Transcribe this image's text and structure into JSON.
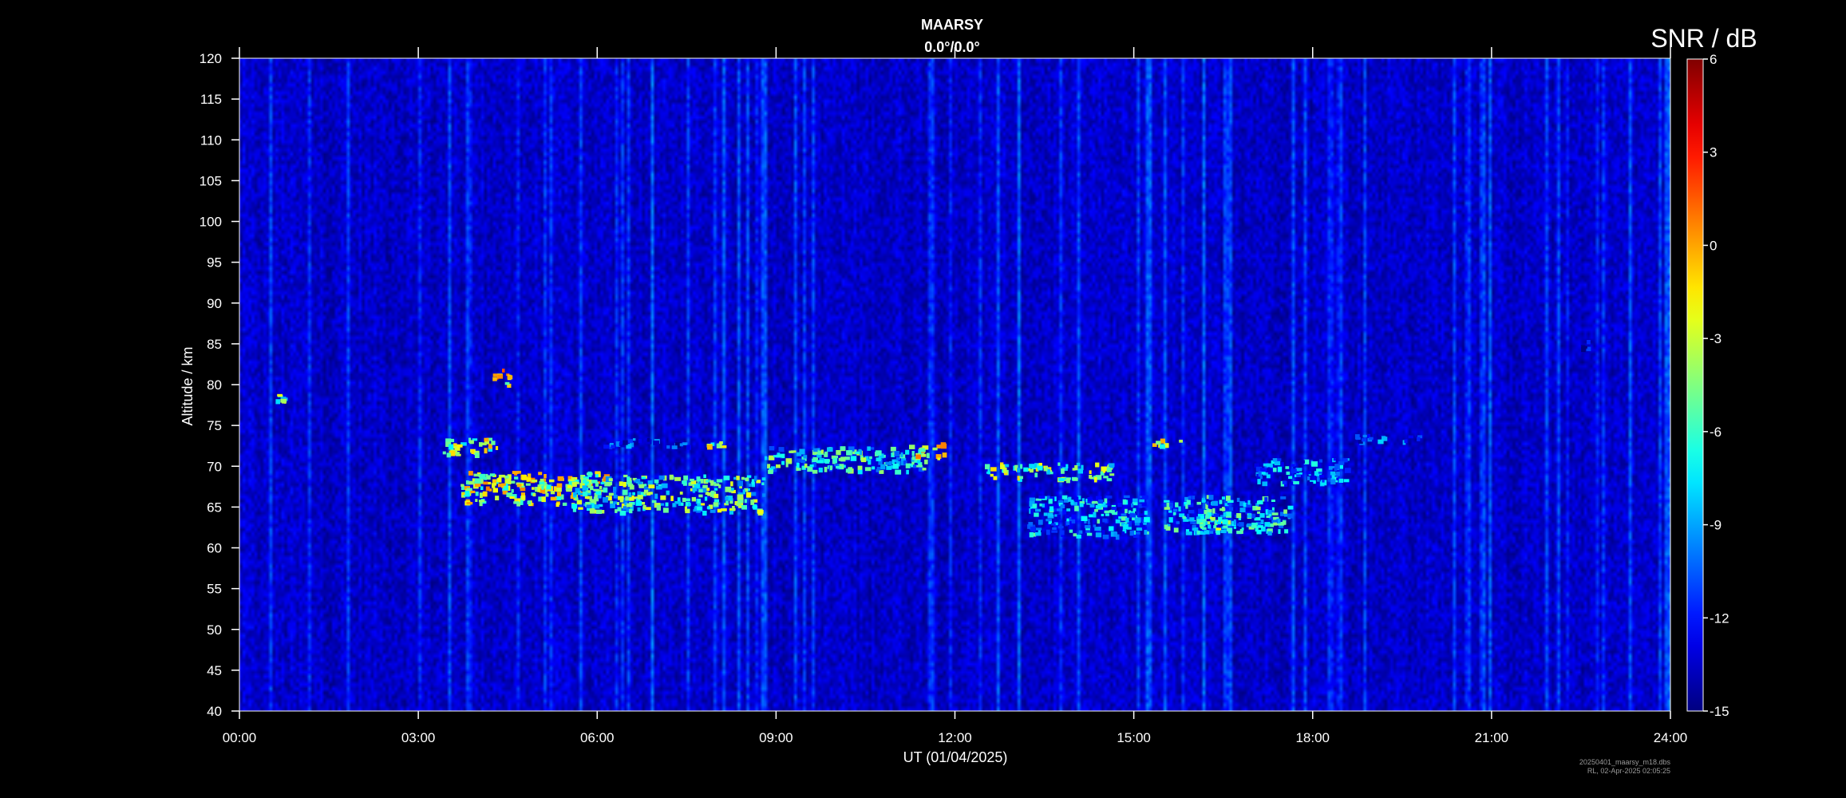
{
  "chart_data": {
    "type": "heatmap",
    "title": "MAARSY",
    "subtitle": "0.0°/0.0°",
    "xlabel": "UT (01/04/2025)",
    "ylabel": "Altitude / km",
    "xlim": [
      0,
      24
    ],
    "ylim": [
      40,
      120
    ],
    "xticks": [
      0,
      3,
      6,
      9,
      12,
      15,
      18,
      21,
      24
    ],
    "xtick_labels": [
      "00:00",
      "03:00",
      "06:00",
      "09:00",
      "12:00",
      "15:00",
      "18:00",
      "21:00",
      "24:00"
    ],
    "yticks": [
      40,
      45,
      50,
      55,
      60,
      65,
      70,
      75,
      80,
      85,
      90,
      95,
      100,
      105,
      110,
      115,
      120
    ],
    "ytick_labels": [
      "40",
      "45",
      "50",
      "55",
      "60",
      "65",
      "70",
      "75",
      "80",
      "85",
      "90",
      "95",
      "100",
      "105",
      "110",
      "115",
      "120"
    ],
    "colorbar": {
      "label": "SNR / dB",
      "range": [
        -15,
        6
      ],
      "ticks": [
        6,
        3,
        0,
        -3,
        -6,
        -9,
        -12,
        -15
      ],
      "tick_labels": [
        "6",
        "3",
        "0",
        "-3",
        "-6",
        "-9",
        "-12",
        "-15"
      ],
      "colormap": "jet",
      "placement": "right"
    },
    "background_snr": -13.5,
    "echo_regions": [
      {
        "t_start": 3.4,
        "t_end": 4.3,
        "alt_low": 71.5,
        "alt_high": 73.5,
        "snr": 0
      },
      {
        "t_start": 3.7,
        "t_end": 6.2,
        "alt_low": 65.5,
        "alt_high": 69.5,
        "snr": 1
      },
      {
        "t_start": 5.5,
        "t_end": 8.8,
        "alt_low": 64.5,
        "alt_high": 69,
        "snr": -2
      },
      {
        "t_start": 4.2,
        "t_end": 4.5,
        "alt_low": 80,
        "alt_high": 82,
        "snr": 2
      },
      {
        "t_start": 6.1,
        "t_end": 7.5,
        "alt_low": 72.5,
        "alt_high": 73.5,
        "snr": -8
      },
      {
        "t_start": 7.8,
        "t_end": 8.1,
        "alt_low": 72.5,
        "alt_high": 73.2,
        "snr": 0
      },
      {
        "t_start": 8.8,
        "t_end": 11.5,
        "alt_low": 69.5,
        "alt_high": 72.5,
        "snr": -3
      },
      {
        "t_start": 11.2,
        "t_end": 11.8,
        "alt_low": 71,
        "alt_high": 73,
        "snr": 1
      },
      {
        "t_start": 12.5,
        "t_end": 14.6,
        "alt_low": 68.5,
        "alt_high": 70.5,
        "snr": -1
      },
      {
        "t_start": 13.2,
        "t_end": 15.2,
        "alt_low": 61.5,
        "alt_high": 66.5,
        "snr": -5
      },
      {
        "t_start": 15.5,
        "t_end": 17.6,
        "alt_low": 62,
        "alt_high": 66.5,
        "snr": -4
      },
      {
        "t_start": 16,
        "t_end": 16.6,
        "alt_low": 62,
        "alt_high": 64,
        "snr": -1
      },
      {
        "t_start": 15.3,
        "t_end": 15.8,
        "alt_low": 72.5,
        "alt_high": 73.5,
        "snr": 0
      },
      {
        "t_start": 17,
        "t_end": 18.6,
        "alt_low": 68,
        "alt_high": 71,
        "snr": -6
      },
      {
        "t_start": 18.7,
        "t_end": 19.8,
        "alt_low": 73,
        "alt_high": 74,
        "snr": -7
      },
      {
        "t_start": 22.5,
        "t_end": 22.6,
        "alt_low": 84.5,
        "alt_high": 85.5,
        "snr": -9
      },
      {
        "t_start": 0.6,
        "t_end": 0.75,
        "alt_low": 78,
        "alt_high": 79,
        "snr": -2
      }
    ]
  },
  "footnote": {
    "line1": "20250401_maarsy_m18.dbs",
    "line2": "RL, 02-Apr-2025 02:05:25"
  }
}
